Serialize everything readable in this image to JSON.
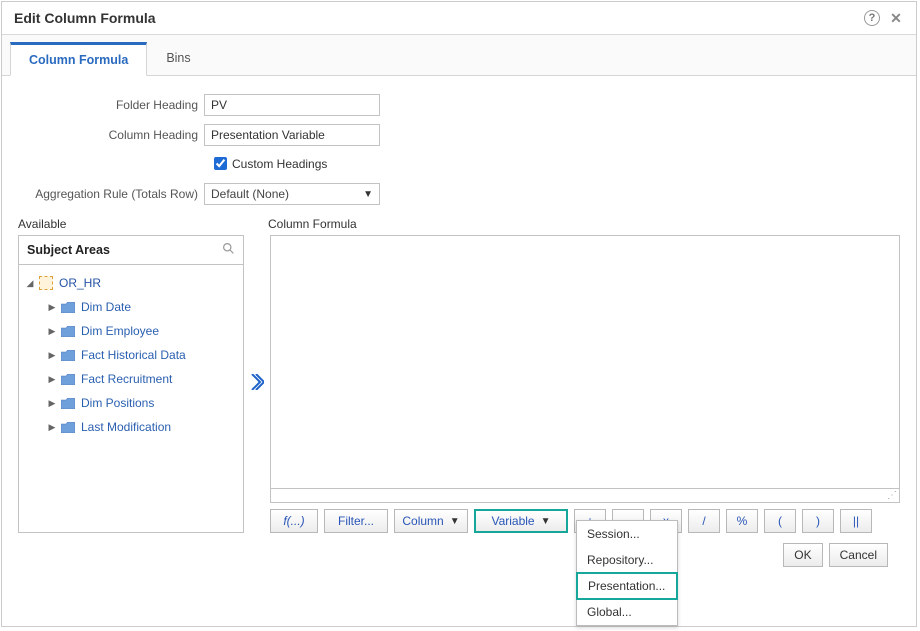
{
  "dialog": {
    "title": "Edit Column Formula"
  },
  "tabs": {
    "column_formula": "Column Formula",
    "bins": "Bins"
  },
  "form": {
    "folder_heading_label": "Folder Heading",
    "folder_heading_value": "PV",
    "column_heading_label": "Column Heading",
    "column_heading_value": "Presentation Variable",
    "custom_headings_label": "Custom Headings",
    "custom_headings_checked": true,
    "aggregation_label": "Aggregation Rule (Totals Row)",
    "aggregation_value": "Default (None)"
  },
  "sections": {
    "available": "Available",
    "column_formula": "Column Formula",
    "subject_areas": "Subject Areas"
  },
  "tree": {
    "root": "OR_HR",
    "items": [
      "Dim Date",
      "Dim Employee",
      "Fact Historical Data",
      "Fact Recruitment",
      "Dim Positions",
      "Last Modification"
    ]
  },
  "formula": {
    "value": ""
  },
  "toolbar": {
    "fx": "f(...)",
    "filter": "Filter...",
    "column": "Column",
    "variable": "Variable",
    "plus": "+",
    "minus": "-",
    "times": "x",
    "div": "/",
    "pct": "%",
    "lparen": "(",
    "rparen": ")",
    "pipes": "||"
  },
  "variable_menu": {
    "session": "Session...",
    "repository": "Repository...",
    "presentation": "Presentation...",
    "global": "Global..."
  },
  "footer": {
    "ok": "OK",
    "cancel": "Cancel"
  }
}
